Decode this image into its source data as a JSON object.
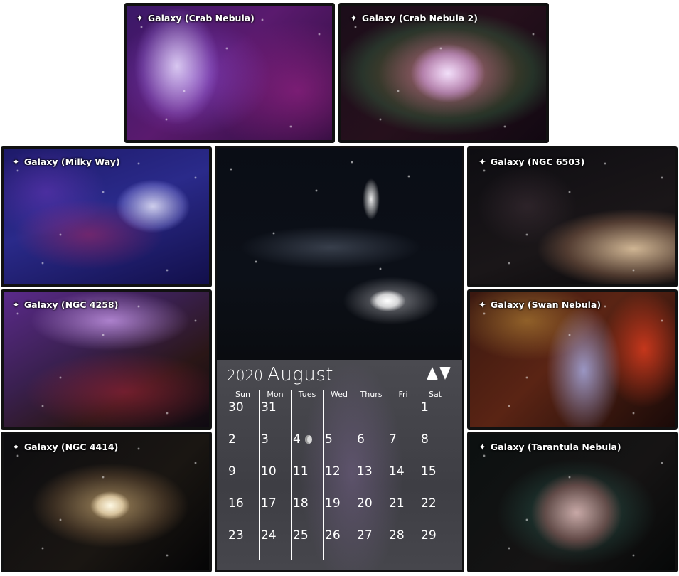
{
  "galleries": [
    {
      "id": "crab1",
      "caption": "Galaxy (Crab Nebula)",
      "star_icon": "sparkle-icon"
    },
    {
      "id": "crab2",
      "caption": "Galaxy (Crab Nebula 2)",
      "star_icon": "sparkle-icon"
    },
    {
      "id": "milky",
      "caption": "Galaxy (Milky Way)",
      "star_icon": "sparkle-icon"
    },
    {
      "id": "ngc4258",
      "caption": "Galaxy (NGC 4258)",
      "star_icon": "sparkle-icon"
    },
    {
      "id": "ngc4414",
      "caption": "Galaxy (NGC 4414)",
      "star_icon": "sparkle-icon"
    },
    {
      "id": "ngc6503",
      "caption": "Galaxy (NGC 6503)",
      "star_icon": "sparkle-icon"
    },
    {
      "id": "swan",
      "caption": "Galaxy (Swan Nebula)",
      "star_icon": "sparkle-icon"
    },
    {
      "id": "tarantula",
      "caption": "Galaxy (Tarantula Nebula)",
      "star_icon": "sparkle-icon"
    }
  ],
  "calendar": {
    "year": "2020",
    "month": "August",
    "weekdays": [
      "Sun",
      "Mon",
      "Tues",
      "Wed",
      "Thurs",
      "Fri",
      "Sat"
    ],
    "weeks": [
      [
        "30",
        "31",
        "",
        "",
        "",
        "",
        "1"
      ],
      [
        "2",
        "3",
        "4",
        "5",
        "6",
        "7",
        "8"
      ],
      [
        "9",
        "10",
        "11",
        "12",
        "13",
        "14",
        "15"
      ],
      [
        "16",
        "17",
        "18",
        "19",
        "20",
        "21",
        "22"
      ],
      [
        "23",
        "24",
        "25",
        "26",
        "27",
        "28",
        "29"
      ]
    ],
    "moon_phase_day": "4",
    "nav": {
      "prev_icon": "triangle-up-icon",
      "next_icon": "triangle-down-icon"
    }
  },
  "colors": {
    "card_border": "#111111",
    "text": "#ffffff",
    "calendar_bg": "#46464c"
  }
}
